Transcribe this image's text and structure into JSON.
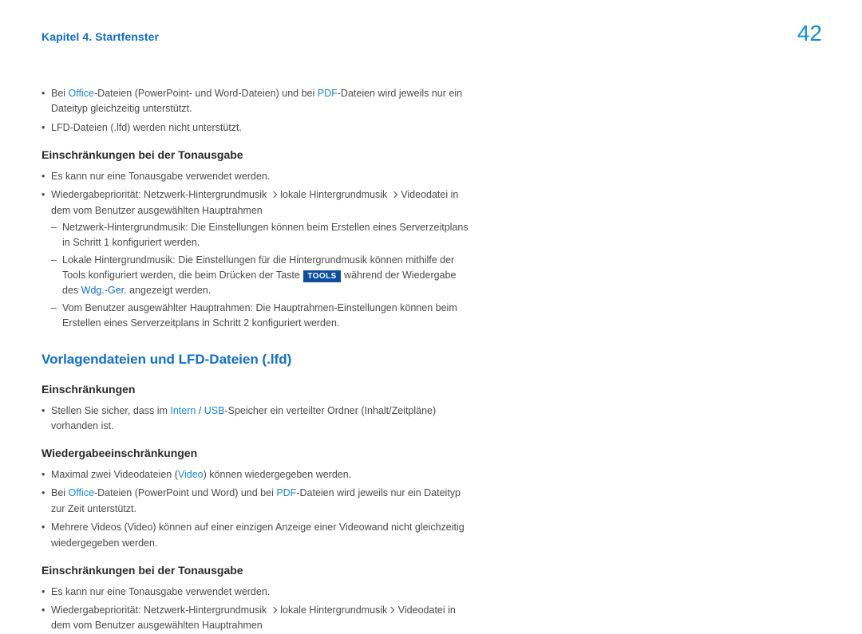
{
  "header": {
    "breadcrumb": "Kapitel 4. Startfenster",
    "page_number": "42"
  },
  "intro_bullets": [
    {
      "pre": "Bei ",
      "office": "Office",
      "mid1": "-Dateien (PowerPoint- und Word-Dateien) und bei ",
      "pdf": "PDF",
      "post": "-Dateien wird jeweils nur ein Dateityp gleichzeitig unterstützt."
    },
    {
      "text": "LFD-Dateien (.lfd) werden nicht unterstützt."
    }
  ],
  "sec_sound1": {
    "title": "Einschränkungen bei der Tonausgabe",
    "b1": "Es kann nur eine Tonausgabe verwendet werden.",
    "b2": {
      "pre": "Wiedergabepriorität: Netzwerk-Hintergrundmusik",
      "mid1": "lokale Hintergrundmusik",
      "post": "Videodatei in dem vom Benutzer ausgewählten Hauptrahmen"
    },
    "d1": "Netzwerk-Hintergrundmusik: Die Einstellungen können beim Erstellen eines Serverzeitplans in Schritt 1 konfiguriert werden.",
    "d2": {
      "pre": "Lokale Hintergrundmusik: Die Einstellungen für die Hintergrundmusik können mithilfe der Tools konfiguriert werden, die beim Drücken der Taste ",
      "chip": "TOOLS",
      "mid": " während der Wiedergabe des ",
      "wdg": "Wdg.-Ger.",
      "post": " angezeigt werden."
    },
    "d3": "Vom Benutzer ausgewählter Hauptrahmen: Die Hauptrahmen-Einstellungen können beim Erstellen eines Serverzeitplans in Schritt 2 konfiguriert werden."
  },
  "sec_lfd": {
    "title": "Vorlagendateien und LFD-Dateien (.lfd)",
    "subA": {
      "title": "Einschränkungen",
      "b1": {
        "pre": "Stellen Sie sicher, dass im ",
        "intern": "Intern",
        "sep": " / ",
        "usb": "USB",
        "post": "-Speicher ein verteilter Ordner (Inhalt/Zeitpläne) vorhanden ist."
      }
    },
    "subB": {
      "title": "Wiedergabeeinschränkungen",
      "b1": {
        "pre": "Maximal zwei Videodateien (",
        "video": "Video",
        "post": ") können wiedergegeben werden."
      },
      "b2": {
        "pre": "Bei ",
        "office": "Office",
        "mid1": "-Dateien (PowerPoint und Word) und bei ",
        "pdf": "PDF",
        "post": "-Dateien wird jeweils nur ein Dateityp zur Zeit unterstützt."
      },
      "b3": "Mehrere Videos (Video) können auf einer einzigen Anzeige einer Videowand nicht gleichzeitig wiedergegeben werden."
    },
    "subC": {
      "title": "Einschränkungen bei der Tonausgabe",
      "b1": "Es kann nur eine Tonausgabe verwendet werden.",
      "b2": {
        "pre": "Wiedergabepriorität: Netzwerk-Hintergrundmusik",
        "mid1": "lokale Hintergrundmusik",
        "post": "Videodatei in dem vom Benutzer ausgewählten Hauptrahmen"
      }
    }
  }
}
